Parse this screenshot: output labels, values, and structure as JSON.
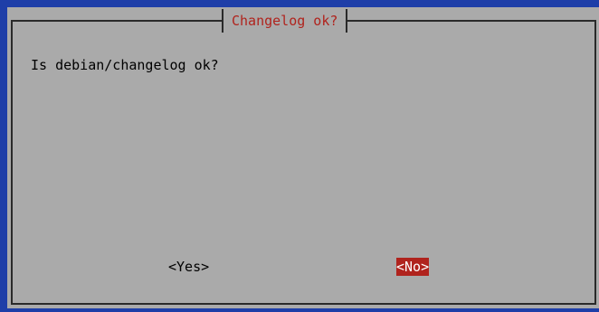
{
  "dialog": {
    "title": "Changelog ok?",
    "message": "Is debian/changelog ok?",
    "buttons": {
      "yes_label": "<Yes>",
      "no_label": "<No>"
    },
    "selected_button": "no"
  },
  "colors": {
    "terminal_background": "#1e3ea8",
    "dialog_background": "#aaaaaa",
    "title_color": "#b0231d",
    "selected_button_background": "#b0231d",
    "selected_button_text": "#ffffff"
  }
}
